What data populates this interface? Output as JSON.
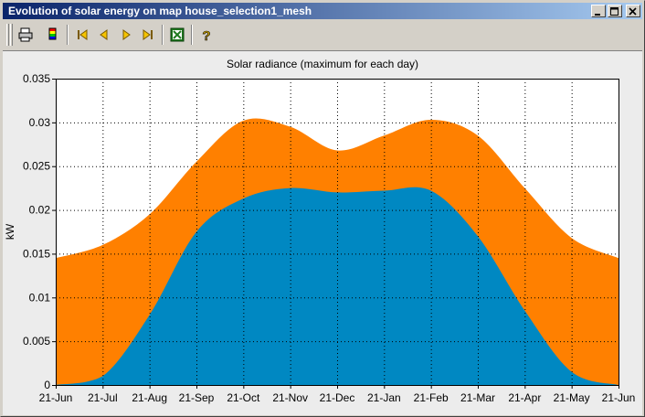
{
  "window": {
    "title": "Evolution of solar energy on map house_selection1_mesh",
    "buttons": [
      "minimize-icon",
      "maximize-icon",
      "close-icon"
    ]
  },
  "toolbar": {
    "items": [
      "printer-icon",
      "color-scale-icon",
      "first-frame-icon",
      "previous-frame-icon",
      "next-frame-icon",
      "last-frame-icon",
      "excel-export-icon",
      "help-icon"
    ]
  },
  "colors": {
    "series_max": "#ff8000",
    "series_inner": "#0088c2"
  },
  "chart_data": {
    "type": "area",
    "title": "Solar radiance (maximum for each day)",
    "ylabel": "kW",
    "xlabel": "",
    "ylim": [
      0,
      0.035
    ],
    "yticks": [
      "0",
      "0.005",
      "0.01",
      "0.015",
      "0.02",
      "0.025",
      "0.03",
      "0.035"
    ],
    "categories": [
      "21-Jun",
      "21-Jul",
      "21-Aug",
      "21-Sep",
      "21-Oct",
      "21-Nov",
      "21-Dec",
      "21-Jan",
      "21-Feb",
      "21-Mar",
      "21-Apr",
      "21-May",
      "21-Jun"
    ],
    "grid": true,
    "series": [
      {
        "color": "#ff8000",
        "values": [
          0.0145,
          0.016,
          0.0195,
          0.0255,
          0.0302,
          0.0295,
          0.0268,
          0.0285,
          0.0303,
          0.0285,
          0.0225,
          0.0168,
          0.0145
        ]
      },
      {
        "color": "#0088c2",
        "values": [
          0.0,
          0.001,
          0.008,
          0.0175,
          0.0213,
          0.0225,
          0.022,
          0.0222,
          0.0222,
          0.017,
          0.0085,
          0.0015,
          0.0
        ]
      }
    ]
  }
}
